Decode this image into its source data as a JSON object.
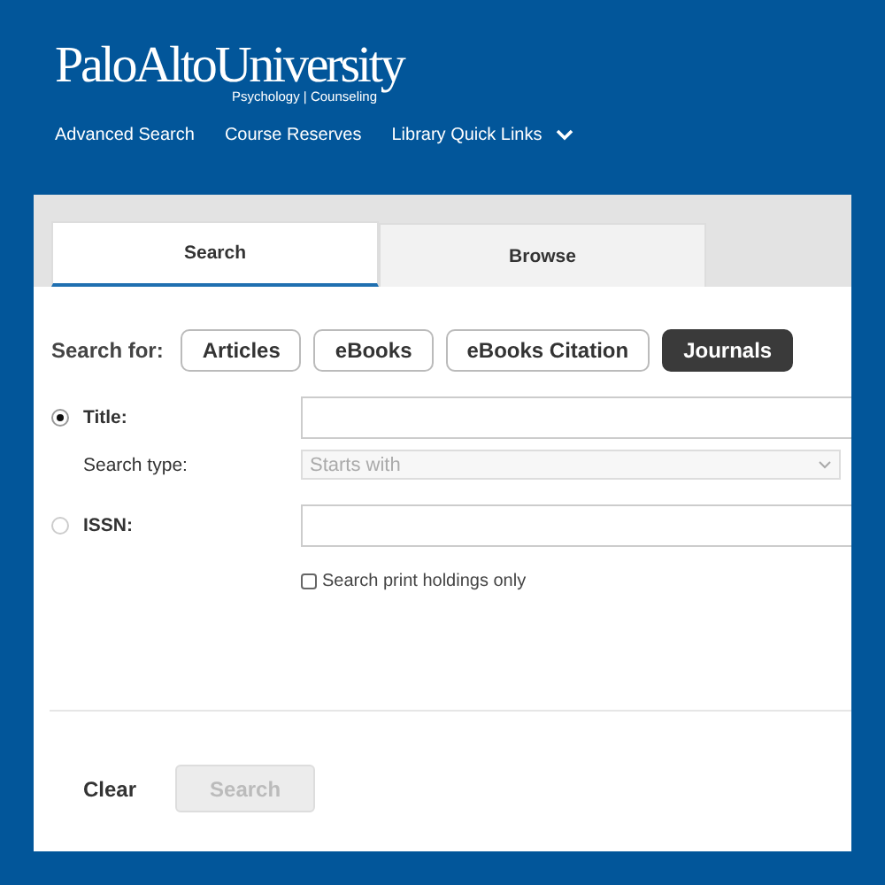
{
  "logo": {
    "name": "PaloAltoUniversity",
    "tagline": "Psychology | Counseling"
  },
  "nav": [
    {
      "label": "Advanced Search",
      "dropdown": false
    },
    {
      "label": "Course Reserves",
      "dropdown": false
    },
    {
      "label": "Library Quick Links",
      "dropdown": true
    }
  ],
  "tabs": [
    {
      "label": "Search",
      "selected": true
    },
    {
      "label": "Browse",
      "selected": false
    }
  ],
  "search_for": {
    "label": "Search for:",
    "options": [
      {
        "label": "Articles",
        "selected": false
      },
      {
        "label": "eBooks",
        "selected": false
      },
      {
        "label": "eBooks Citation",
        "selected": false
      },
      {
        "label": "Journals",
        "selected": true
      }
    ]
  },
  "rows": [
    {
      "kind": "radio-text",
      "label": "Title:",
      "selected": true
    },
    {
      "kind": "select",
      "label": "Search type:",
      "value": "Starts with",
      "disabled": true
    },
    {
      "kind": "radio-text",
      "label": "ISSN:",
      "selected": false
    },
    {
      "kind": "checkbox",
      "label": "Search print holdings only",
      "checked": false
    }
  ],
  "actions": [
    {
      "label": "Clear",
      "kind": "link",
      "disabled": false
    },
    {
      "label": "Search",
      "kind": "button",
      "disabled": true
    }
  ]
}
